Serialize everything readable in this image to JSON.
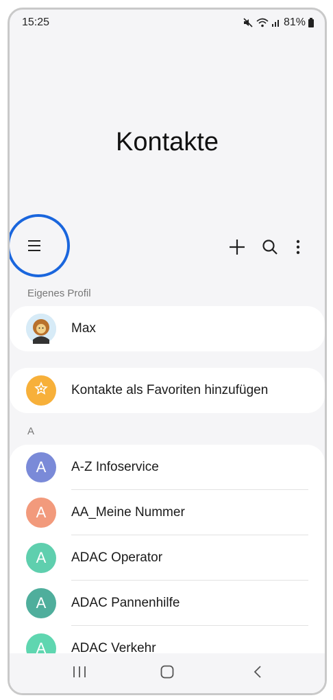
{
  "status_bar": {
    "time": "15:25",
    "battery": "81%"
  },
  "header": {
    "title": "Kontakte"
  },
  "toolbar": {
    "menu_icon": "menu-icon",
    "add_icon": "plus-icon",
    "search_icon": "search-icon",
    "more_icon": "more-vert-icon"
  },
  "profile_section": {
    "label": "Eigenes Profil",
    "name": "Max"
  },
  "favorites": {
    "label": "Kontakte als Favoriten hinzufügen"
  },
  "contacts_section": {
    "letter": "A",
    "contacts": [
      {
        "initial": "A",
        "name": "A-Z Infoservice",
        "color": "#7a8ad8"
      },
      {
        "initial": "A",
        "name": "AA_Meine Nummer",
        "color": "#f29a7c"
      },
      {
        "initial": "A",
        "name": "ADAC Operator",
        "color": "#5fcfae"
      },
      {
        "initial": "A",
        "name": "ADAC Pannenhilfe",
        "color": "#4fae9c"
      },
      {
        "initial": "A",
        "name": "ADAC Verkehr",
        "color": "#5fd6b0"
      }
    ]
  },
  "colors": {
    "highlight": "#1a66dd",
    "favorites_icon": "#f7b03a"
  },
  "nav": {
    "recent_icon": "recent-apps-icon",
    "home_icon": "home-icon",
    "back_icon": "back-icon"
  }
}
